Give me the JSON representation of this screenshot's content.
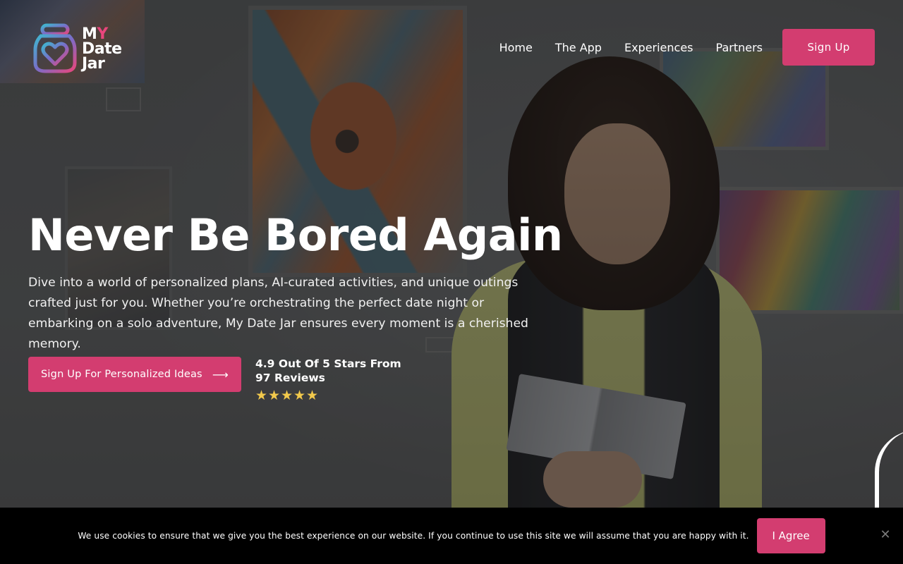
{
  "brand": {
    "logo_line1_a": "M",
    "logo_line1_b": "Y",
    "logo_line2": "Date",
    "logo_line3": "Jar",
    "accent_color": "#d33d70"
  },
  "nav": {
    "items": [
      {
        "label": "Home"
      },
      {
        "label": "The App"
      },
      {
        "label": "Experiences"
      },
      {
        "label": "Partners"
      }
    ],
    "signup_label": "Sign Up"
  },
  "hero": {
    "title": "Never Be Bored Again",
    "description": "Dive into a world of personalized plans, AI-curated activities, and unique outings crafted just for you. Whether you’re orchestrating the perfect date night or embarking on a solo adventure, My Date Jar ensures every moment is a cherished memory.",
    "cta_label": "Sign Up For Personalized Ideas",
    "cta_icon": "arrow-right-icon",
    "rating_text": "4.9 Out Of 5 Stars From 97 Reviews",
    "rating_stars": 5,
    "star_color": "#f2c94c"
  },
  "cookie": {
    "message": "We use cookies to ensure that we give you the best experience on our website. If you continue to use this site we will assume that you are happy with it.",
    "agree_label": "I Agree",
    "close_icon": "close-icon"
  }
}
